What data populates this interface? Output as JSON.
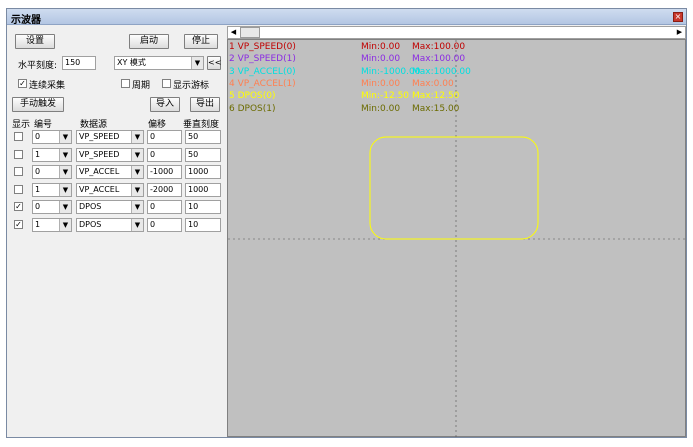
{
  "window": {
    "title": "示波器",
    "close_icon": "close-icon"
  },
  "toolbar": {
    "settings": "设置",
    "start": "启动",
    "stop": "停止",
    "collapse": "<<"
  },
  "horizontal": {
    "label": "水平刻度:",
    "value": "150",
    "mode": "XY 模式"
  },
  "options": {
    "continuous": "连续采集",
    "continuous_checked": true,
    "periodic": "周期",
    "periodic_checked": false,
    "show_cursor": "显示游标",
    "show_cursor_checked": false
  },
  "actions": {
    "manual_trigger": "手动触发",
    "import": "导入",
    "export": "导出"
  },
  "table": {
    "headers": {
      "show": "显示",
      "index": "编号",
      "source": "数据源",
      "offset": "偏移",
      "vscale": "垂直刻度"
    },
    "rows": [
      {
        "show": false,
        "index": "0",
        "source": "VP_SPEED",
        "offset": "0",
        "vscale": "50"
      },
      {
        "show": false,
        "index": "1",
        "source": "VP_SPEED",
        "offset": "0",
        "vscale": "50"
      },
      {
        "show": false,
        "index": "0",
        "source": "VP_ACCEL",
        "offset": "-1000",
        "vscale": "1000"
      },
      {
        "show": false,
        "index": "1",
        "source": "VP_ACCEL",
        "offset": "-2000",
        "vscale": "1000"
      },
      {
        "show": true,
        "index": "0",
        "source": "DPOS",
        "offset": "0",
        "vscale": "10"
      },
      {
        "show": true,
        "index": "1",
        "source": "DPOS",
        "offset": "0",
        "vscale": "10"
      }
    ]
  },
  "scope": {
    "traces": [
      {
        "name": "1 VP_SPEED(0)",
        "min": "Min:0.00",
        "max": "Max:100.00",
        "color": "#c00000"
      },
      {
        "name": "2 VP_SPEED(1)",
        "min": "Min:0.00",
        "max": "Max:100.00",
        "color": "#8a2be2"
      },
      {
        "name": "3 VP_ACCEL(0)",
        "min": "Min:-1000.00",
        "max": "Max:1000.00",
        "color": "#00e0e0"
      },
      {
        "name": "4 VP_ACCEL(1)",
        "min": "Min:0.00",
        "max": "Max:0.00",
        "color": "#ff7f50"
      },
      {
        "name": "5 DPOS(0)",
        "min": "Min:-12.50",
        "max": "Max:12.50",
        "color": "#ffff00"
      },
      {
        "name": "6 DPOS(1)",
        "min": "Min:0.00",
        "max": "Max:15.00",
        "color": "#6b6b00"
      }
    ],
    "curve_color": "#ffff00"
  }
}
